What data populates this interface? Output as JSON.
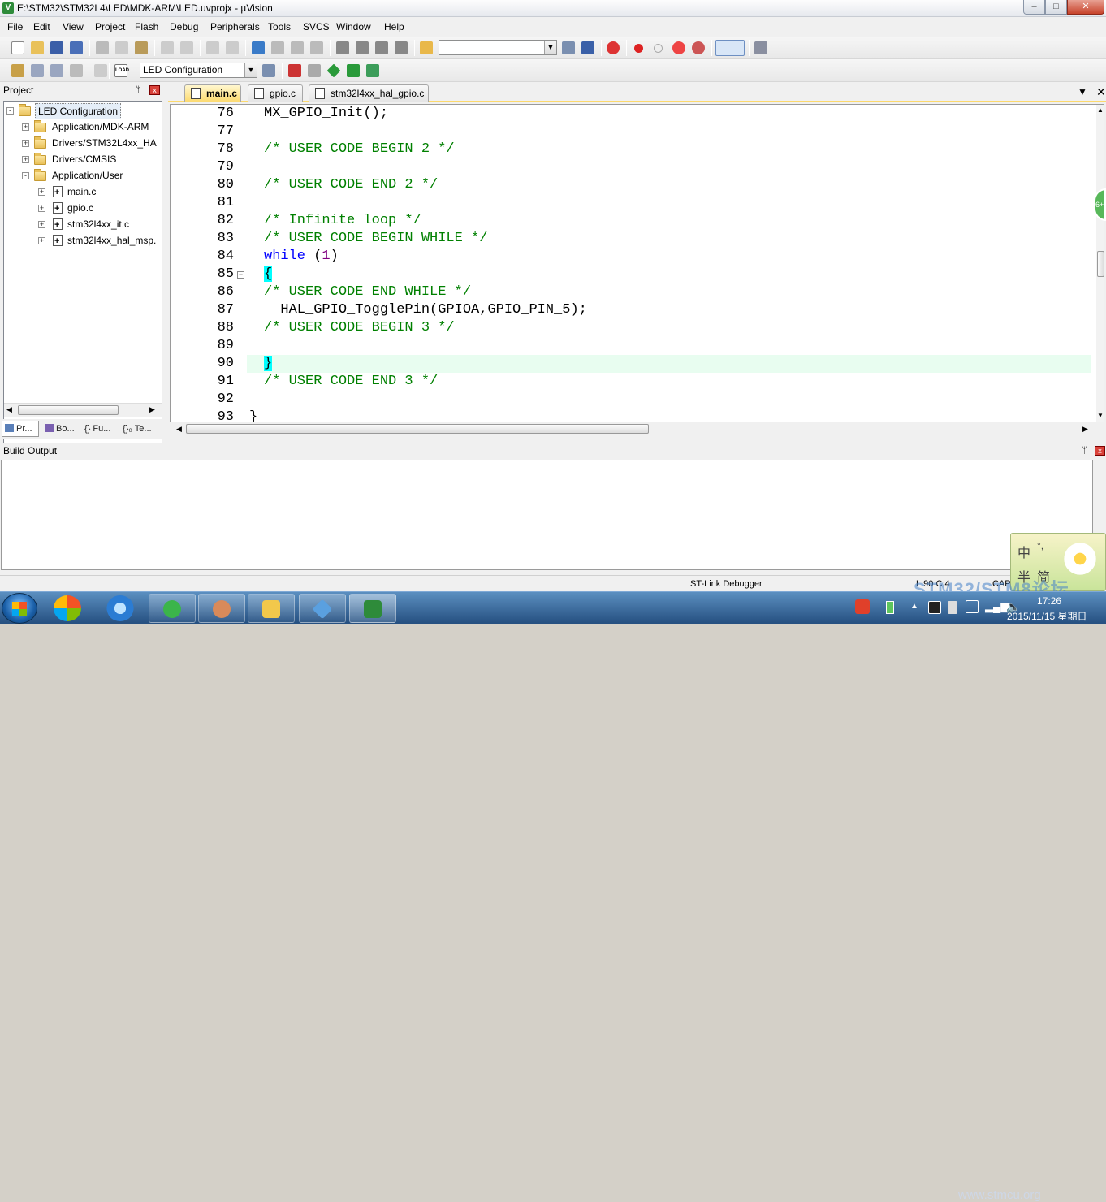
{
  "window": {
    "title": "E:\\STM32\\STM32L4\\LED\\MDK-ARM\\LED.uvprojx - µVision",
    "app_icon": "V",
    "minimize": "–",
    "maximize": "□",
    "close": "✕"
  },
  "menu": [
    "File",
    "Edit",
    "View",
    "Project",
    "Flash",
    "Debug",
    "Peripherals",
    "Tools",
    "SVCS",
    "Window",
    "Help"
  ],
  "toolbar": {
    "search_combo_value": "",
    "target_combo_value": "LED Configuration",
    "load_label": "LOAD"
  },
  "project": {
    "header": "Project",
    "pin": "ᛘ",
    "close": "x",
    "tree": [
      {
        "label": "LED Configuration",
        "level": 0,
        "type": "root",
        "expander": "-"
      },
      {
        "label": "Application/MDK-ARM",
        "level": 1,
        "type": "folder",
        "expander": "+"
      },
      {
        "label": "Drivers/STM32L4xx_HA",
        "level": 1,
        "type": "folder",
        "expander": "+"
      },
      {
        "label": "Drivers/CMSIS",
        "level": 1,
        "type": "folder",
        "expander": "+"
      },
      {
        "label": "Application/User",
        "level": 1,
        "type": "folder",
        "expander": "-"
      },
      {
        "label": "main.c",
        "level": 2,
        "type": "file",
        "expander": "+"
      },
      {
        "label": "gpio.c",
        "level": 2,
        "type": "file",
        "expander": "+"
      },
      {
        "label": "stm32l4xx_it.c",
        "level": 2,
        "type": "file",
        "expander": "+"
      },
      {
        "label": "stm32l4xx_hal_msp.",
        "level": 2,
        "type": "file",
        "expander": "+"
      }
    ],
    "tabs": [
      "Pr...",
      "Bo...",
      "{} Fu...",
      "{}₀ Te..."
    ]
  },
  "editor": {
    "tabs": [
      {
        "label": "main.c",
        "active": true
      },
      {
        "label": "gpio.c",
        "active": false
      },
      {
        "label": "stm32l4xx_hal_gpio.c",
        "active": false
      }
    ],
    "tab_menu": "▼",
    "tab_close": "✕",
    "lines": [
      {
        "n": "76",
        "text": "MX_GPIO_Init();",
        "kind": "code"
      },
      {
        "n": "77",
        "text": "",
        "kind": "code"
      },
      {
        "n": "78",
        "text": "/* USER CODE BEGIN 2 */",
        "kind": "comment"
      },
      {
        "n": "79",
        "text": "",
        "kind": "code"
      },
      {
        "n": "80",
        "text": "/* USER CODE END 2 */",
        "kind": "comment"
      },
      {
        "n": "81",
        "text": "",
        "kind": "code"
      },
      {
        "n": "82",
        "text": "/* Infinite loop */",
        "kind": "comment"
      },
      {
        "n": "83",
        "text": "/* USER CODE BEGIN WHILE */",
        "kind": "comment"
      },
      {
        "n": "84",
        "text": "while",
        "kind": "while",
        "arg": "1"
      },
      {
        "n": "85",
        "text": "{",
        "kind": "brace"
      },
      {
        "n": "86",
        "text": "/* USER CODE END WHILE */",
        "kind": "comment"
      },
      {
        "n": "87",
        "text": "  HAL_GPIO_TogglePin(GPIOA,GPIO_PIN_5);",
        "kind": "code"
      },
      {
        "n": "88",
        "text": "/* USER CODE BEGIN 3 */",
        "kind": "comment"
      },
      {
        "n": "89",
        "text": "",
        "kind": "code"
      },
      {
        "n": "90",
        "text": "}",
        "kind": "brace"
      },
      {
        "n": "91",
        "text": "/* USER CODE END 3 */",
        "kind": "comment"
      },
      {
        "n": "92",
        "text": "",
        "kind": "code"
      },
      {
        "n": "93",
        "text": "}",
        "kind": "outer"
      }
    ],
    "fold_marker": "−"
  },
  "build_output": {
    "header": "Build Output"
  },
  "status": {
    "debugger": "ST-Link Debugger",
    "position": "L:90 C:4",
    "caps": "CAP"
  },
  "ime": {
    "c1": "中",
    "c2": "°,",
    "c3": "半",
    "c4": "简"
  },
  "watermark": {
    "line1": "STM32/STM8论坛",
    "line2": "www.stmcu.org"
  },
  "side_badge": "6+",
  "taskbar": {
    "time": "17:26",
    "date": "2015/11/15 星期日"
  },
  "colors": {
    "comment": "#008000",
    "keyword": "#0000ff",
    "number": "#800080",
    "brace_highlight": "#00ffff",
    "active_tab": "#fcd96c",
    "current_line": "#e8fdf0"
  }
}
